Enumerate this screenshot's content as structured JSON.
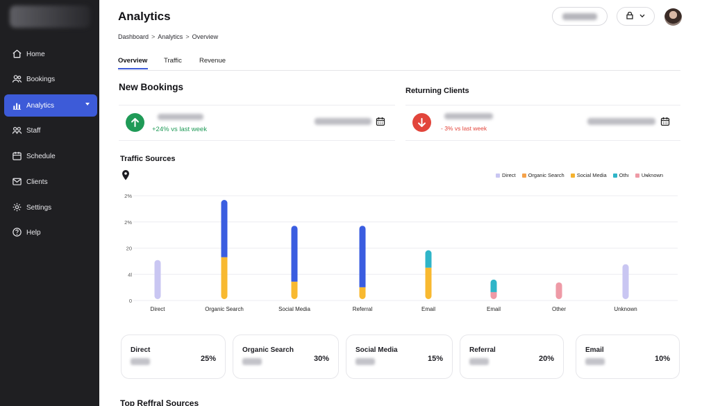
{
  "sidebar": {
    "items": [
      {
        "label": "Home",
        "icon": "home-icon"
      },
      {
        "label": "Bookings",
        "icon": "users-icon"
      },
      {
        "label": "Analytics",
        "icon": "bar-chart-icon",
        "active": true
      },
      {
        "label": "Staff",
        "icon": "team-icon"
      },
      {
        "label": "Schedule",
        "icon": "calendar-icon"
      },
      {
        "label": "Clients",
        "icon": "mail-icon"
      },
      {
        "label": "Settings",
        "icon": "gear-icon"
      },
      {
        "label": "Help",
        "icon": "help-icon"
      }
    ]
  },
  "header": {
    "title": "Analytics",
    "breadcrumb": [
      "Dashboard",
      "Analytics",
      "Overview"
    ]
  },
  "tabs": [
    "Overview",
    "Traffic",
    "Revenue"
  ],
  "new_bookings": {
    "title": "New Bookings",
    "change": "+24% vs last week"
  },
  "returning_clients": {
    "title": "Returning Clients",
    "change": "- 3% vs last week"
  },
  "traffic_sources": {
    "title": "Traffic Sources"
  },
  "chart_data": {
    "type": "bar",
    "stacked": true,
    "categories": [
      "Direct",
      "Organic Search",
      "Social Media",
      "Referral",
      "Email",
      "Email",
      "Other",
      "Unknown"
    ],
    "y_tick_labels": [
      "0",
      "4l",
      "20",
      "2%",
      "2%"
    ],
    "legend": [
      {
        "label": "Direct",
        "color": "#c9c6f2"
      },
      {
        "label": "Organic Search",
        "color": "#f5a24a"
      },
      {
        "label": "Social Media",
        "color": "#f5b22e"
      },
      {
        "label": "Othı",
        "color": "#2fb5c8"
      },
      {
        "label": "Uɴknown",
        "color": "#ee9aa6"
      }
    ],
    "series": [
      {
        "key": "direct",
        "color": "#c9c6f2",
        "values": [
          58,
          0,
          0,
          0,
          0,
          0,
          0,
          52
        ]
      },
      {
        "key": "yellow",
        "color": "#f8b930",
        "values": [
          0,
          62,
          27,
          19,
          47,
          0,
          0,
          0
        ]
      },
      {
        "key": "pink",
        "color": "#ee9aa6",
        "values": [
          0,
          0,
          0,
          0,
          0,
          12,
          26,
          0
        ]
      },
      {
        "key": "teal",
        "color": "#2fb5c8",
        "values": [
          0,
          0,
          0,
          0,
          25,
          18,
          0,
          0
        ]
      },
      {
        "key": "blue",
        "color": "#3a5de0",
        "values": [
          0,
          82,
          80,
          88,
          0,
          0,
          0,
          0
        ]
      }
    ],
    "ylim": [
      0,
      150
    ],
    "grid": true,
    "legend_position": "top-right"
  },
  "source_cards": [
    {
      "name": "Direct",
      "percent": "25%"
    },
    {
      "name": "Organic Search",
      "percent": "30%"
    },
    {
      "name": "Social Media",
      "percent": "15%"
    },
    {
      "name": "Referral",
      "percent": "20%"
    },
    {
      "name": "Email",
      "percent": "10%"
    }
  ],
  "bottom_title": "Top Reffral Sources",
  "colors": {
    "accent": "#3d5bd8",
    "positive": "#1f9a57",
    "negative": "#e2453b",
    "sidebar_bg": "#1f1f22"
  }
}
